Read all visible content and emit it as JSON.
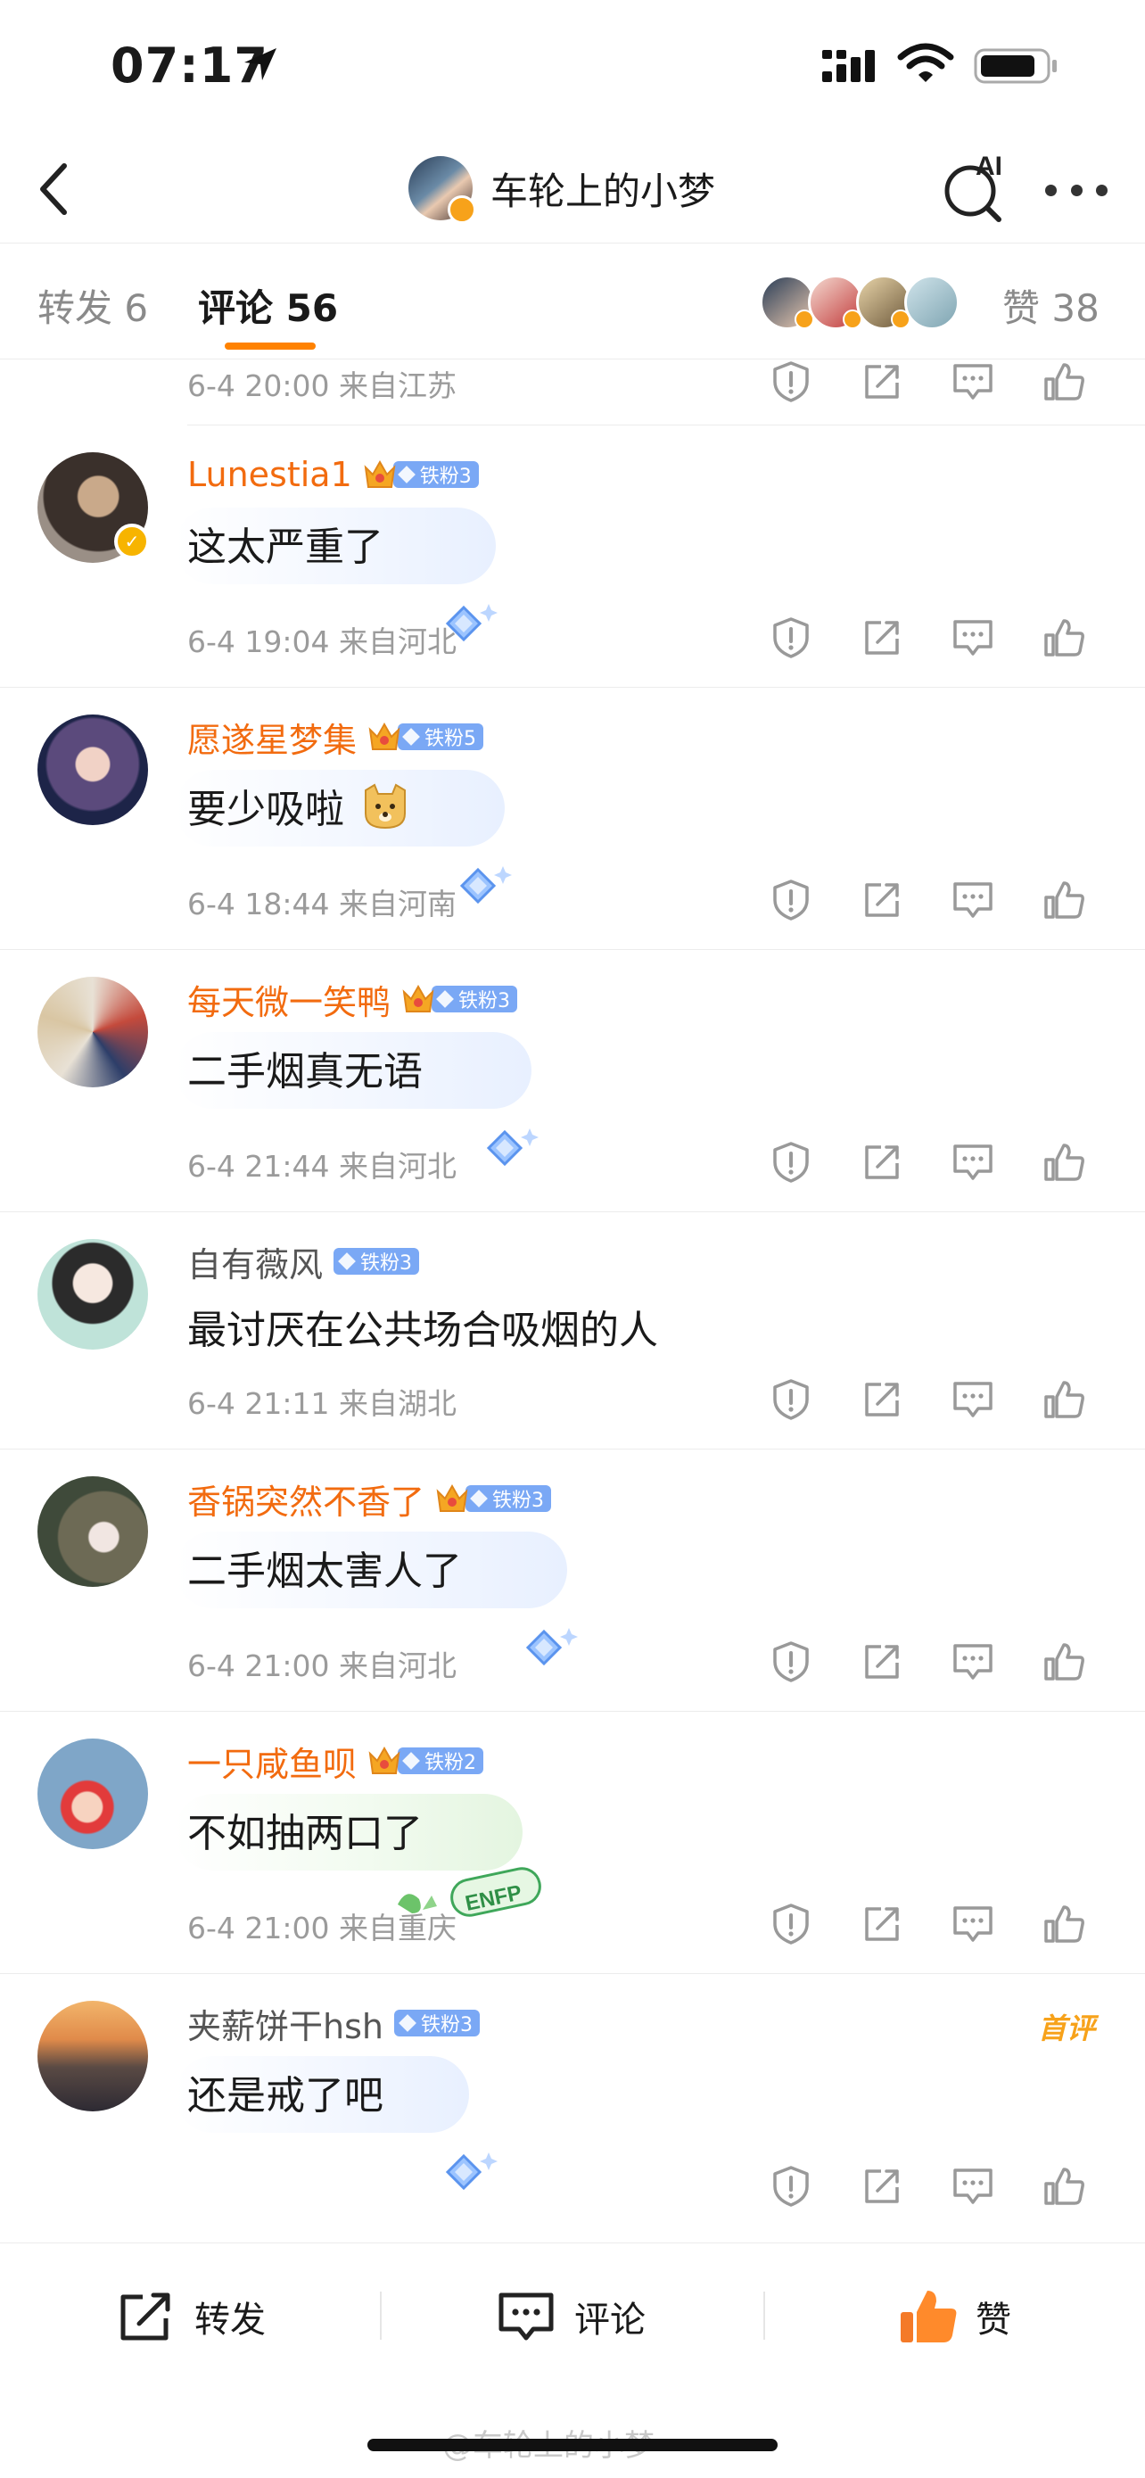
{
  "status_bar": {
    "time": "07:17"
  },
  "nav": {
    "title": "车轮上的小梦",
    "ai_label": "AI"
  },
  "tabs": {
    "repost": "转发 6",
    "comments": "评论 56",
    "likes": "赞 38"
  },
  "first_row": {
    "meta": "6-4 20:00  来自江苏"
  },
  "comments": [
    {
      "name": "Lunestia1",
      "vip": true,
      "fan": "铁粉3",
      "text": "这太严重了",
      "meta": "6-4 19:04  来自河北"
    },
    {
      "name": "愿遂星梦集",
      "vip": true,
      "fan": "铁粉5",
      "text": "要少吸啦",
      "meta": "6-4 18:44  来自河南"
    },
    {
      "name": "每天微一笑鸭",
      "vip": true,
      "fan": "铁粉3",
      "text": "二手烟真无语",
      "meta": "6-4 21:44  来自河北"
    },
    {
      "name": "自有薇风",
      "vip": false,
      "fan": "铁粉3",
      "text": "最讨厌在公共场合吸烟的人",
      "meta": "6-4 21:11  来自湖北"
    },
    {
      "name": "香锅突然不香了",
      "vip": true,
      "fan": "铁粉3",
      "text": "二手烟太害人了",
      "meta": "6-4 21:00  来自河北"
    },
    {
      "name": "一只咸鱼呗",
      "vip": true,
      "fan": "铁粉2",
      "text": "不如抽两口了",
      "meta": "6-4 21:00  来自重庆",
      "bubble_tag": "ENFP"
    },
    {
      "name": "夹薪饼干hsh",
      "vip": false,
      "fan": "铁粉3",
      "text": "还是戒了吧",
      "meta": "",
      "first_tag": "首评"
    }
  ],
  "bottom": {
    "repost": "转发",
    "comment": "评论",
    "like": "赞"
  },
  "watermark": "@车轮上的小梦",
  "colors": {
    "accent": "#ff8200",
    "vip_name": "#f26b0f",
    "fan_badge": "#7aa8f5"
  }
}
